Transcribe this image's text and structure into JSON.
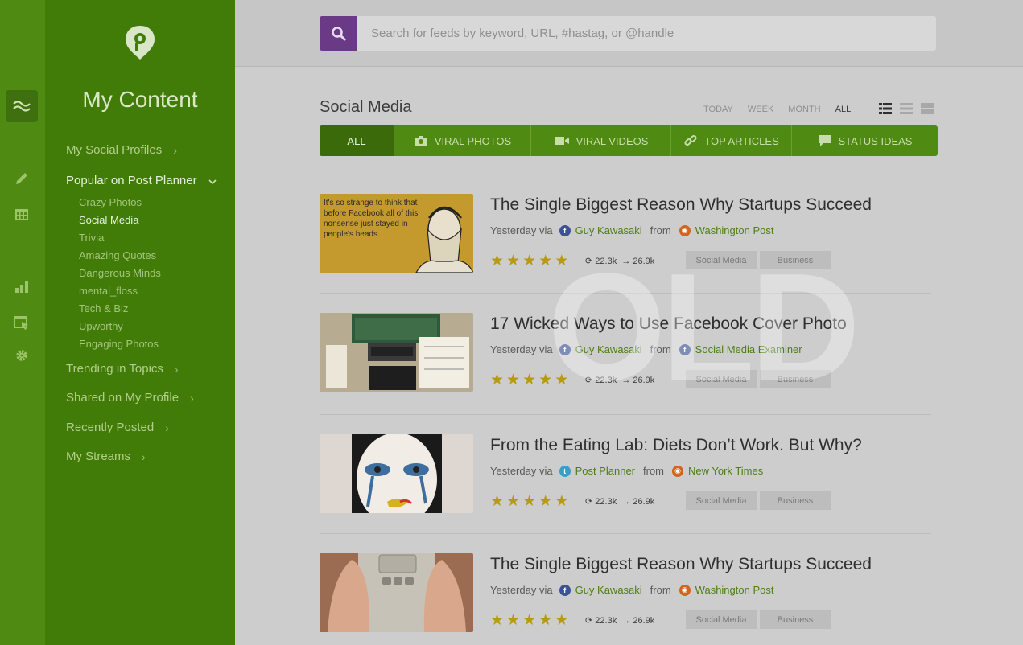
{
  "sidebar": {
    "title": "My Content",
    "items": [
      {
        "label": "My Social Profiles"
      },
      {
        "label": "Popular on Post Planner"
      },
      {
        "label": "Trending in Topics"
      },
      {
        "label": "Shared on My Profile"
      },
      {
        "label": "Recently Posted"
      },
      {
        "label": "My Streams"
      }
    ],
    "popular_sub": [
      "Crazy Photos",
      "Social Media",
      "Trivia",
      "Amazing Quotes",
      "Dangerous Minds",
      "mental_floss",
      "Tech & Biz",
      "Upworthy",
      "Engaging Photos"
    ]
  },
  "rail": {
    "icons": [
      "streams-icon",
      "pencil-icon",
      "calendar-icon",
      "bar-chart-icon",
      "window-cursor-icon",
      "gear-icon"
    ]
  },
  "search": {
    "placeholder": "Search for feeds by keyword, URL, #hastag, or @handle"
  },
  "main": {
    "title": "Social Media",
    "time_filters": [
      "TODAY",
      "WEEK",
      "MONTH",
      "ALL"
    ],
    "active_time_filter": "ALL",
    "tabs": [
      {
        "label": "ALL",
        "icon": "none"
      },
      {
        "label": "VIRAL PHOTOS",
        "icon": "camera-icon"
      },
      {
        "label": "VIRAL VIDEOS",
        "icon": "video-camera-icon"
      },
      {
        "label": "TOP ARTICLES",
        "icon": "link-icon"
      },
      {
        "label": "STATUS IDEAS",
        "icon": "speech-bubble-icon"
      }
    ]
  },
  "feed": [
    {
      "title": "The Single Biggest Reason Why Startups Succeed",
      "when": "Yesterday via",
      "author": "Guy Kawasaki",
      "from_label": "from",
      "source": "Washington Post",
      "rating": 5,
      "shares": "22.3k",
      "clicks": "26.9k",
      "tags": [
        "Social Media",
        "Business"
      ],
      "thumb_text": "It's so strange to think that before Facebook all of this nonsense just stayed in people's heads."
    },
    {
      "title": "17 Wicked Ways to Use Facebook Cover Photo",
      "when": "Yesterday via",
      "author": "Guy Kawasaki",
      "from_label": "from",
      "source": "Social Media Examiner",
      "rating": 5,
      "shares": "22.3k",
      "clicks": "26.9k",
      "tags": [
        "Social Media",
        "Business"
      ]
    },
    {
      "title": "From the Eating Lab: Diets Don’t Work. But Why?",
      "when": "Yesterday via",
      "author": "Post Planner",
      "from_label": "from",
      "source": "New York Times",
      "rating": 5,
      "shares": "22.3k",
      "clicks": "26.9k",
      "tags": [
        "Social Media",
        "Business"
      ]
    },
    {
      "title": "The Single Biggest Reason Why Startups Succeed",
      "when": "Yesterday via",
      "author": "Guy Kawasaki",
      "from_label": "from",
      "source": "Washington Post",
      "rating": 5,
      "shares": "22.3k",
      "clicks": "26.9k",
      "tags": [
        "Social Media",
        "Business"
      ]
    }
  ],
  "watermark": "OLD",
  "colors": {
    "green_dark": "#427c08",
    "green": "#4f8a12",
    "purple": "#6b3a86",
    "star": "#b89a10"
  }
}
